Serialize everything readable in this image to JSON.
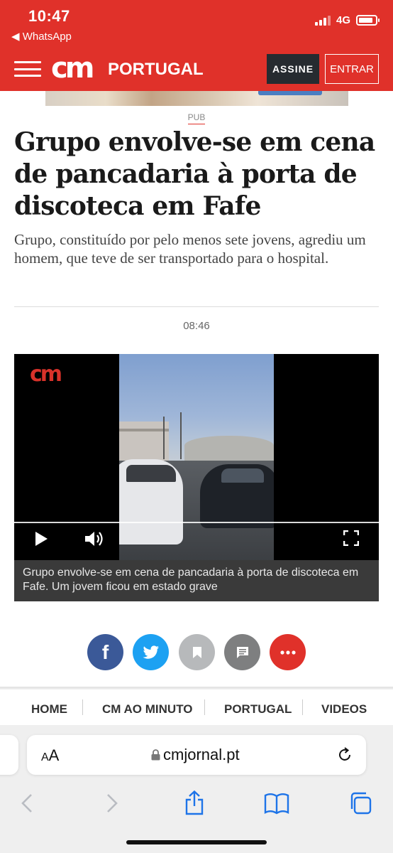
{
  "status_bar": {
    "time": "10:47",
    "back_app": "◀ WhatsApp",
    "network": "4G"
  },
  "header": {
    "logo": "cm",
    "edition": "PORTUGAL",
    "subscribe_label": "ASSINE",
    "login_label": "ENTRAR",
    "brand_color": "#e0312a"
  },
  "ad": {
    "label": "PUB"
  },
  "article": {
    "headline": "Grupo envolve-se em cena de pancadaria à porta de discoteca em Fafe",
    "lead": "Grupo, constituído por pelo menos sete jovens, agrediu um homem, que teve de ser transportado para o hospital.",
    "time": "08:46"
  },
  "video": {
    "logo": "cm",
    "caption": "Grupo envolve-se em cena de pancadaria à porta de discoteca em Fafe. Um jovem ficou em estado grave",
    "controls": [
      "play-icon",
      "volume-icon",
      "fullscreen-icon"
    ]
  },
  "share": {
    "buttons": [
      {
        "name": "facebook",
        "icon": "facebook-icon",
        "color": "#3b5998"
      },
      {
        "name": "twitter",
        "icon": "twitter-icon",
        "color": "#1da1f2"
      },
      {
        "name": "bookmark",
        "icon": "bookmark-icon",
        "color": "#b7b9bb"
      },
      {
        "name": "comments",
        "icon": "comment-icon",
        "color": "#7e7f80"
      },
      {
        "name": "more",
        "icon": "more-icon",
        "color": "#e0312a"
      }
    ]
  },
  "site_nav": {
    "items": [
      "HOME",
      "CM AO MINUTO",
      "PORTUGAL",
      "VIDEOS"
    ]
  },
  "browser": {
    "text_size_small": "A",
    "text_size_large": "A",
    "url": "cmjornal.pt"
  }
}
